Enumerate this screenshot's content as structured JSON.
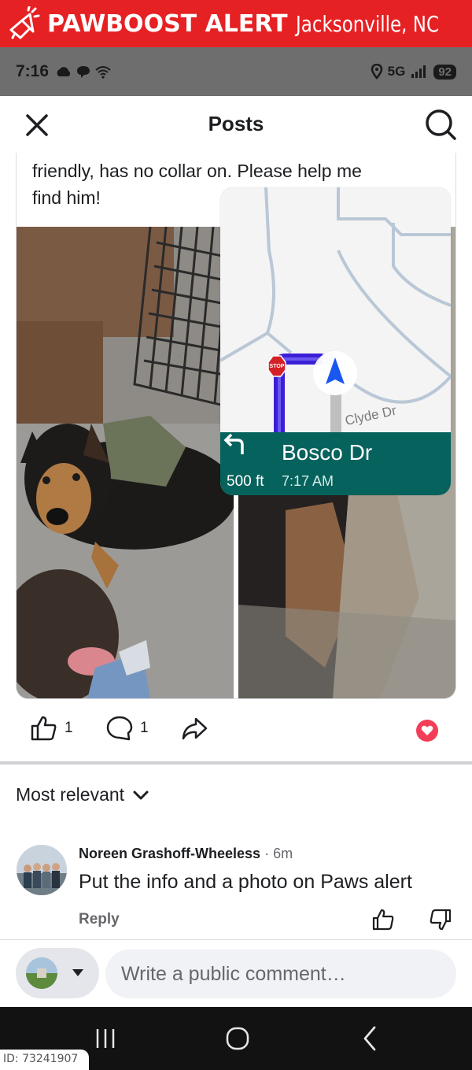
{
  "alert": {
    "title": "PAWBOOST ALERT",
    "location": "Jacksonville, NC",
    "icon": "megaphone-icon",
    "color": "#e52124"
  },
  "status_bar": {
    "time": "7:16",
    "network": "5G",
    "battery": "92"
  },
  "header": {
    "title": "Posts",
    "close_icon": "close-icon",
    "search_icon": "search-icon"
  },
  "post": {
    "text_line1": "friendly, has no collar on. Please help me",
    "text_line2": "find him!",
    "map": {
      "stop_sign": "STOP",
      "street_label": "Clyde Dr",
      "next_street": "Bosco Dr",
      "distance": "500 ft",
      "eta": "7:17 AM",
      "panel_color": "#06625c"
    }
  },
  "actions": {
    "like_count": "1",
    "comment_count": "1",
    "reaction": "heart"
  },
  "comments": {
    "sort_label": "Most relevant",
    "items": [
      {
        "author": "Noreen Grashoff-Wheeless",
        "time": "· 6m",
        "text": "Put the info and a photo on Paws alert",
        "reply_label": "Reply"
      }
    ]
  },
  "composer": {
    "placeholder": "Write a public comment…"
  },
  "watermark": {
    "id": "ID: 73241907"
  }
}
